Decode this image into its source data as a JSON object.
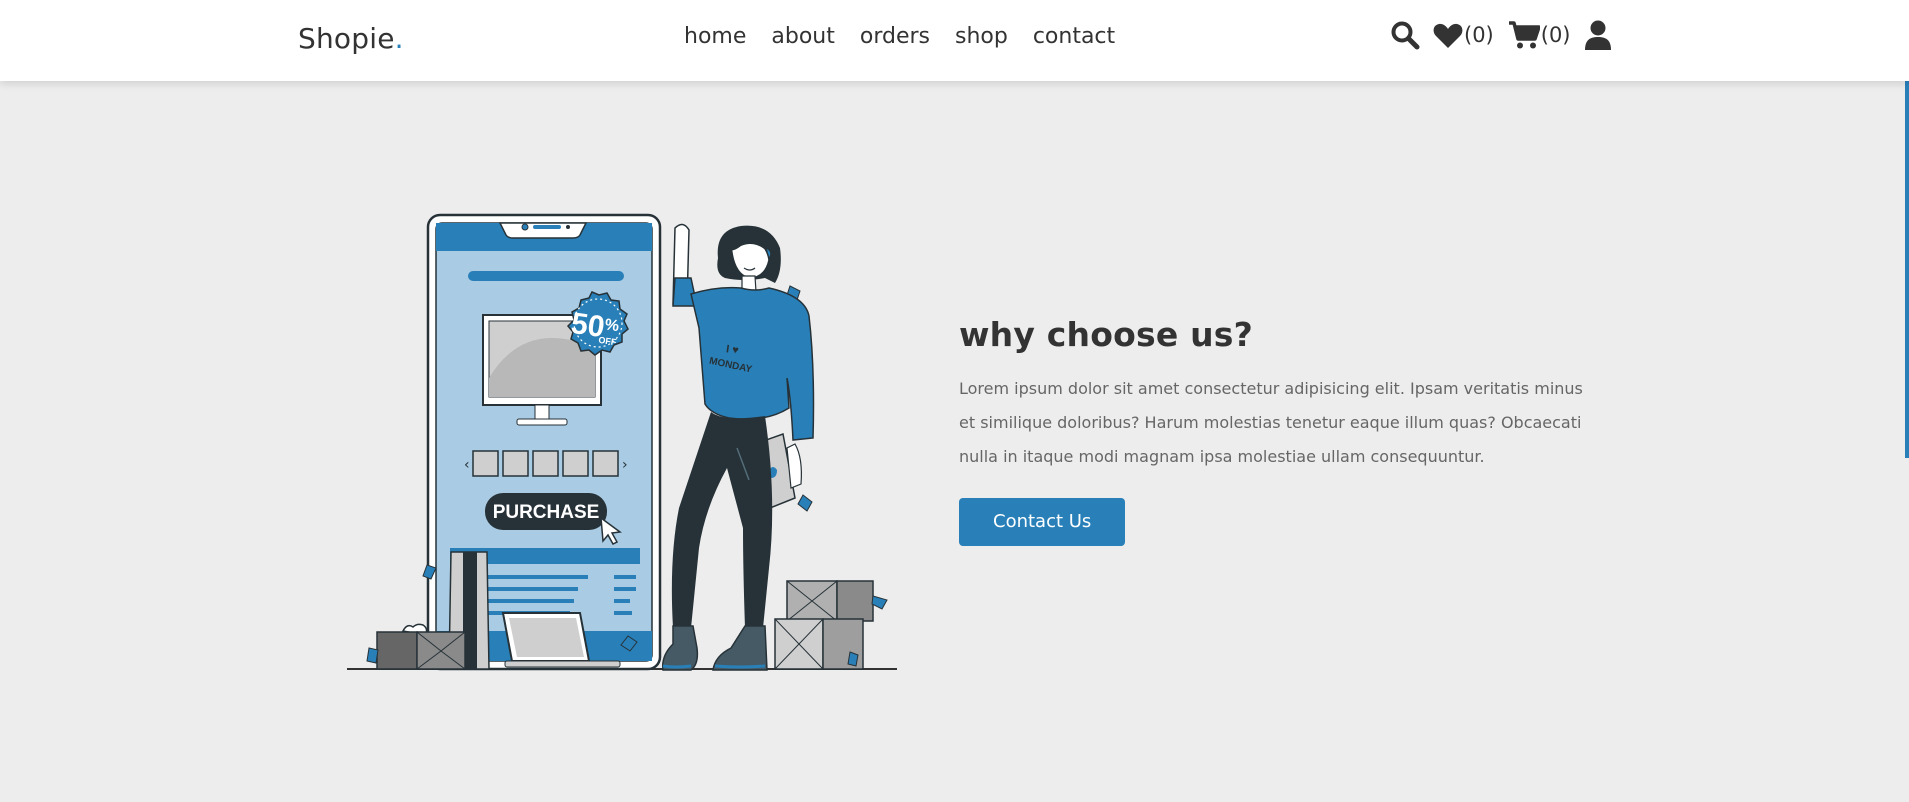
{
  "header": {
    "logo_text": "Shopie",
    "logo_dot": ".",
    "nav": [
      "home",
      "about",
      "orders",
      "shop",
      "contact"
    ],
    "wishlist_count": "(0)",
    "cart_count": "(0)"
  },
  "hero": {
    "illustration": {
      "discount_big": "50",
      "discount_pct": "%",
      "discount_off": "OFF",
      "button_text": "PURCHASE",
      "shirt_line1": "I",
      "shirt_line2": "MONDAY"
    },
    "title": "why choose us?",
    "description": "Lorem ipsum dolor sit amet consectetur adipisicing elit. Ipsam veritatis minus et similique doloribus? Harum molestias tenetur eaque illum quas? Obcaecati nulla in itaque modi magnam ipsa molestiae ullam consequuntur.",
    "cta_label": "Contact Us"
  },
  "colors": {
    "accent": "#2980b9",
    "background": "#ededed",
    "header_bg": "#ffffff",
    "text": "#333333"
  }
}
